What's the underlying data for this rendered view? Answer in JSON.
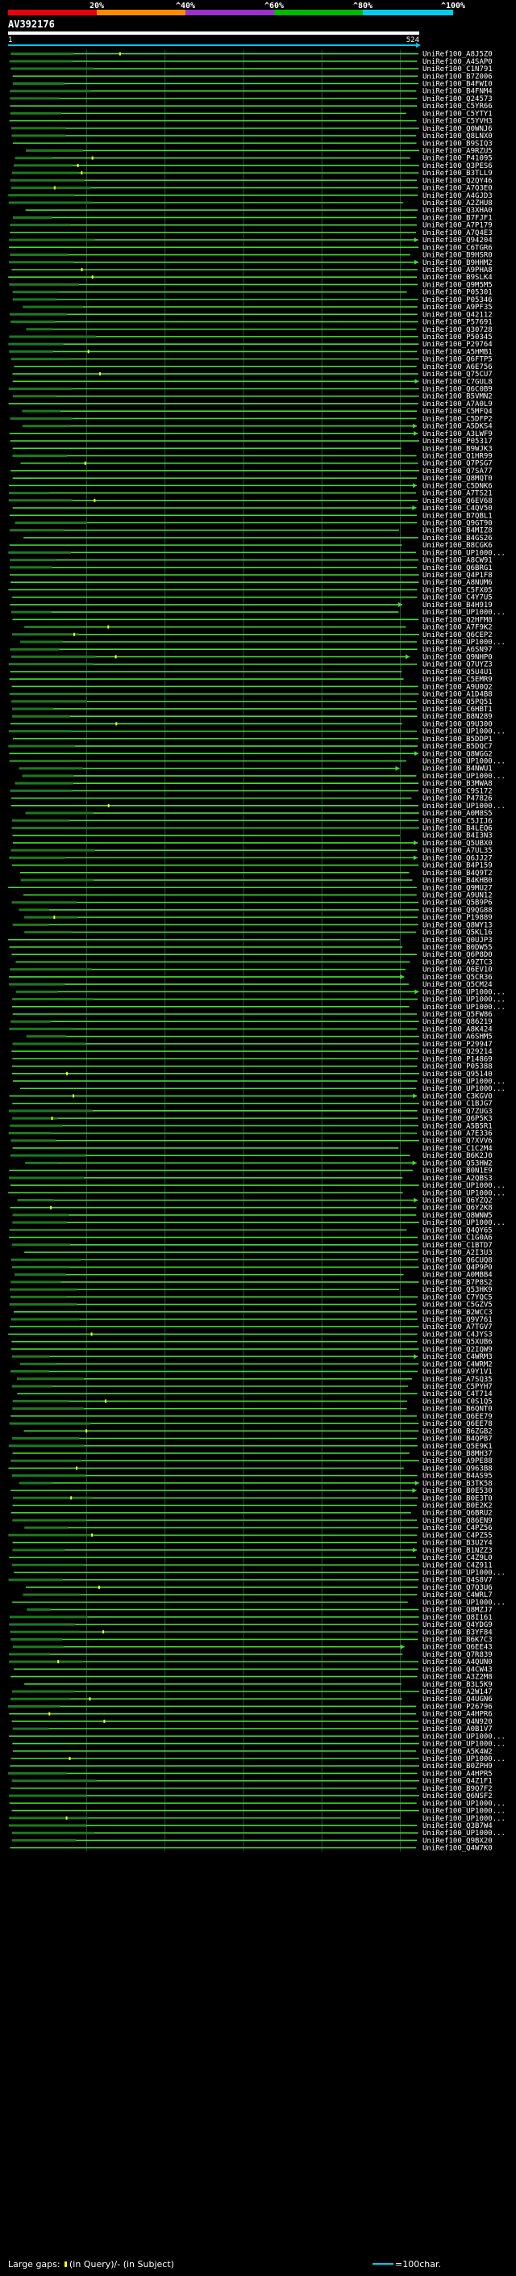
{
  "title": "AV392176",
  "scale": {
    "labels": [
      "20%",
      "^40%",
      "^60%",
      "^80%",
      "^100%"
    ],
    "colors": [
      "#e8000b",
      "#ff8c00",
      "#9932cc",
      "#00b800",
      "#00ccee"
    ]
  },
  "query_start": "1",
  "query_end": "524",
  "colors": {
    "query_bar": "#ffffff",
    "query_line": "#00c8ff",
    "hit": "#44dd33",
    "hit_dark": "#1d7a1d",
    "gap_marker": "#ffff00",
    "grid": "#26543a"
  },
  "hits": [
    "UniRef100_A8J5Z0",
    "UniRef100_A4SAP0",
    "UniRef100_C1N791",
    "UniRef100_B7Z006",
    "UniRef100_B4FWI0",
    "UniRef100_B4FNM4",
    "UniRef100_Q24573",
    "UniRef100_C5YR66",
    "UniRef100_C5YTY1",
    "UniRef100_C5YVH3",
    "UniRef100_Q0WNJ6",
    "UniRef100_Q8LNX0",
    "UniRef100_B9SIQ3",
    "UniRef100_A9RZU5",
    "UniRef100_P41095",
    "UniRef100_Q3PES6",
    "UniRef100_B3TLL9",
    "UniRef100_Q2QY46",
    "UniRef100_A7Q3E0",
    "UniRef100_A4GJD3",
    "UniRef100_A2ZHU8",
    "UniRef100_Q3XHA0",
    "UniRef100_B7FJF1",
    "UniRef100_A7P179",
    "UniRef100_A7Q4E3",
    "UniRef100_Q94204",
    "UniRef100_C6TGR6",
    "UniRef100_B9HSR0",
    "UniRef100_B9HHM2",
    "UniRef100_A9PHA8",
    "UniRef100_B9SLK4",
    "UniRef100_Q9M5M5",
    "UniRef100_P05301",
    "UniRef100_P05346",
    "UniRef100_A9PF35",
    "UniRef100_Q42112",
    "UniRef100_P57691",
    "UniRef100_Q30728",
    "UniRef100_P50345",
    "UniRef100_P29764",
    "UniRef100_A5HMB1",
    "UniRef100_Q6FTP5",
    "UniRef100_A6E756",
    "UniRef100_Q75CU7",
    "UniRef100_C7GUL8",
    "UniRef100_Q6C0B9",
    "UniRef100_B5VMN2",
    "UniRef100_A7A0L9",
    "UniRef100_C5MFQ4",
    "UniRef100_C5DFP2",
    "UniRef100_A5DKS4",
    "UniRef100_A3LWF9",
    "UniRef100_P05317",
    "UniRef100_B9WJK3",
    "UniRef100_Q1HR99",
    "UniRef100_Q7PSG7",
    "UniRef100_Q7SA77",
    "UniRef100_Q8MQT0",
    "UniRef100_C5DNK6",
    "UniRef100_A7TS21",
    "UniRef100_Q6EV68",
    "UniRef100_C4QV50",
    "UniRef100_B7QBL1",
    "UniRef100_Q9GT90",
    "UniRef100_B4MIZ8",
    "UniRef100_B4GS26",
    "UniRef100_B8CGK6",
    "UniRef100_UP1000...",
    "UniRef100_A8CW91",
    "UniRef100_Q6BRG1",
    "UniRef100_Q4P1F8",
    "UniRef100_A8NUM6",
    "UniRef100_C5FX05",
    "UniRef100_C4Y7U5",
    "UniRef100_B4H919",
    "UniRef100_UP1000...",
    "UniRef100_Q2HFM8",
    "UniRef100_A7F9K2",
    "UniRef100_Q6CEP2",
    "UniRef100_UP1000...",
    "UniRef100_A6SN97",
    "UniRef100_Q9NHP0",
    "UniRef100_Q7UYZ3",
    "UniRef100_Q5U4U1",
    "UniRef100_C5EMR9",
    "UniRef100_A9U0Q2",
    "UniRef100_A1D4B8",
    "UniRef100_Q5PQ51",
    "UniRef100_C6HBT1",
    "UniRef100_B8N289",
    "UniRef100_Q9U300",
    "UniRef100_UP1000...",
    "UniRef100_B5DDP1",
    "UniRef100_B5DQC7",
    "UniRef100_Q8WGG2",
    "UniRef100_UP1000...",
    "UniRef100_B4NWU1",
    "UniRef100_UP1000...",
    "UniRef100_B3MWA8",
    "UniRef100_C9S172",
    "UniRef100_P47826",
    "UniRef100_UP1000...",
    "UniRef100_A0M8S5",
    "UniRef100_C5JIJ6",
    "UniRef100_B4LEQ6",
    "UniRef100_B4I3N3",
    "UniRef100_Q5UBX0",
    "UniRef100_A7UL35",
    "UniRef100_Q6JJ27",
    "UniRef100_B4P159",
    "UniRef100_B4Q9T2",
    "UniRef100_B4KHB0",
    "UniRef100_Q9MU27",
    "UniRef100_A9UN12",
    "UniRef100_Q5B9P6",
    "UniRef100_Q9QG88",
    "UniRef100_P19889",
    "UniRef100_Q8WY13",
    "UniRef100_Q5KL16",
    "UniRef100_Q0UJP3",
    "UniRef100_B0DW55",
    "UniRef100_Q6P8D0",
    "UniRef100_A9ZTC3",
    "UniRef100_Q6EV10",
    "UniRef100_Q5CR36",
    "UniRef100_Q5CM24",
    "UniRef100_UP1000...",
    "UniRef100_UP1000...",
    "UniRef100_UP1000...",
    "UniRef100_Q5FW86",
    "UniRef100_Q86219",
    "UniRef100_A8K424",
    "UniRef100_A6SHM5",
    "UniRef100_P29947",
    "UniRef100_Q29214",
    "UniRef100_P14869",
    "UniRef100_P05388",
    "UniRef100_Q95140",
    "UniRef100_UP1000...",
    "UniRef100_UP1000...",
    "UniRef100_C3KGV0",
    "UniRef100_C1BJG7",
    "UniRef100_Q7ZUG3",
    "UniRef100_Q6P5K3",
    "UniRef100_A5B5R1",
    "UniRef100_A7E336",
    "UniRef100_Q7XVV6",
    "UniRef100_C1C2M4",
    "UniRef100_B6K2J0",
    "UniRef100_Q53HW2",
    "UniRef100_B0N1E9",
    "UniRef100_A2QBS3",
    "UniRef100_UP1000...",
    "UniRef100_UP1000...",
    "UniRef100_Q6YZQ2",
    "UniRef100_Q6Y2K8",
    "UniRef100_Q8WNW5",
    "UniRef100_UP1000...",
    "UniRef100_Q4QY65",
    "UniRef100_C1G0A6",
    "UniRef100_C1BTD7",
    "UniRef100_A2I3U3",
    "UniRef100_Q6CUQ8",
    "UniRef100_Q4P9P0",
    "UniRef100_A0MBB4",
    "UniRef100_B7P8S2",
    "UniRef100_Q53HK9",
    "UniRef100_C7YQC5",
    "UniRef100_C5GZV5",
    "UniRef100_B2WCC3",
    "UniRef100_Q9V761",
    "UniRef100_A7TGV7",
    "UniRef100_C4JYS3",
    "UniRef100_Q5XUB6",
    "UniRef100_Q2IQW9",
    "UniRef100_C4WRM3",
    "UniRef100_C4WRM2",
    "UniRef100_A9Y1V1",
    "UniRef100_A7SQ35",
    "UniRef100_C5PYH7",
    "UniRef100_C4T714",
    "UniRef100_C0S1Q5",
    "UniRef100_B6QNT0",
    "UniRef100_Q6EE79",
    "UniRef100_Q6EE78",
    "UniRef100_B6ZGB2",
    "UniRef100_B4QPB7",
    "UniRef100_Q5E9K1",
    "UniRef100_B8MH37",
    "UniRef100_A9PE88",
    "UniRef100_Q963B8",
    "UniRef100_B4AS95",
    "UniRef100_B3TK58",
    "UniRef100_B0E530",
    "UniRef100_B0E3T0",
    "UniRef100_B0E2K2",
    "UniRef100_Q6BRU2",
    "UniRef100_Q86EN9",
    "UniRef100_C4PZ56",
    "UniRef100_C4PZ55",
    "UniRef100_B3U2Y4",
    "UniRef100_B1NZZ3",
    "UniRef100_C4Z9L0",
    "UniRef100_C4Z911",
    "UniRef100_UP1000...",
    "UniRef100_Q4S8V7",
    "UniRef100_Q7Q3U6",
    "UniRef100_C4WRL7",
    "UniRef100_UP1000...",
    "UniRef100_Q8MZJ7",
    "UniRef100_Q8I161",
    "UniRef100_Q4YDG9",
    "UniRef100_B3YF84",
    "UniRef100_B6K7C3",
    "UniRef100_Q6EE43",
    "UniRef100_Q7R839",
    "UniRef100_A4QUN0",
    "UniRef100_Q4CW43",
    "UniRef100_A3Z2M8",
    "UniRef100_B3L5K9",
    "UniRef100_A2W147",
    "UniRef100_Q4UGN6",
    "UniRef100_P26796",
    "UniRef100_A4HPR6",
    "UniRef100_Q4N920",
    "UniRef100_A0B1V7",
    "UniRef100_UP1000...",
    "UniRef100_UP1000...",
    "UniRef100_A5K4W2",
    "UniRef100_UP1000...",
    "UniRef100_B0ZPH9",
    "UniRef100_A4HPR5",
    "UniRef100_Q4Z1F1",
    "UniRef100_B9Q7F2",
    "UniRef100_Q6NSF2",
    "UniRef100_UP1000...",
    "UniRef100_UP1000...",
    "UniRef100_UP1000...",
    "UniRef100_Q3B7W4",
    "UniRef100_UP1000...",
    "UniRef100_Q9BX20",
    "UniRef100_Q4W7K0"
  ],
  "legend": {
    "gaps_label": "Large gaps:",
    "gaps_text": "(in Query)/- (in Subject)",
    "scale_text": "=100char."
  }
}
